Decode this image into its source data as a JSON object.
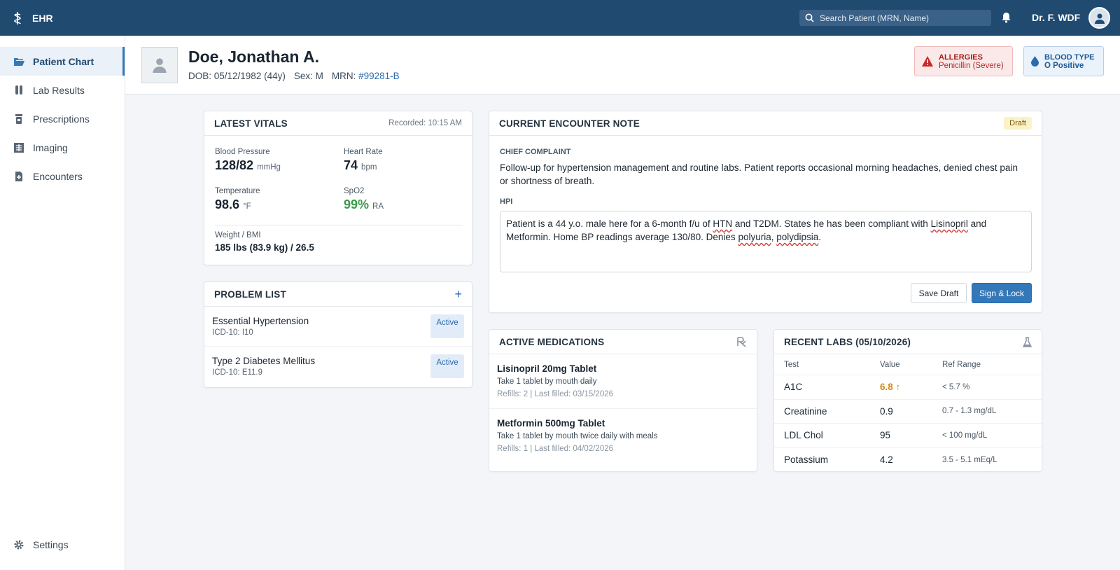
{
  "app": {
    "name": "EHR"
  },
  "topbar": {
    "search_placeholder": "Search Patient (MRN, Name)",
    "user_name": "Dr. F. WDF"
  },
  "sidebar": {
    "items": [
      {
        "label": "Patient Chart",
        "icon": "folder-open-icon",
        "active": true
      },
      {
        "label": "Lab Results",
        "icon": "test-tubes-icon",
        "active": false
      },
      {
        "label": "Prescriptions",
        "icon": "pill-bottle-icon",
        "active": false
      },
      {
        "label": "Imaging",
        "icon": "xray-icon",
        "active": false
      },
      {
        "label": "Encounters",
        "icon": "file-medical-icon",
        "active": false
      }
    ],
    "settings_label": "Settings"
  },
  "patient": {
    "name": "Doe, Jonathan A.",
    "dob": "DOB: 05/12/1982 (44y)",
    "sex": "Sex: M",
    "mrn_label": "MRN:",
    "mrn": "#99281-B",
    "allergies_label": "ALLERGIES",
    "allergies_value": "Penicillin (Severe)",
    "blood_type_label": "BLOOD TYPE",
    "blood_type_value": "O Positive"
  },
  "vitals": {
    "title": "LATEST VITALS",
    "recorded": "Recorded: 10:15 AM",
    "bp_label": "Blood Pressure",
    "bp_value": "128/82",
    "bp_unit": "mmHg",
    "hr_label": "Heart Rate",
    "hr_value": "74",
    "hr_unit": "bpm",
    "temp_label": "Temperature",
    "temp_value": "98.6",
    "temp_unit": "°F",
    "spo2_label": "SpO2",
    "spo2_value": "99%",
    "spo2_unit": "RA",
    "weight_label": "Weight / BMI",
    "weight_value": "185 lbs (83.9 kg) / 26.5"
  },
  "problems": {
    "title": "PROBLEM LIST",
    "add": "+",
    "items": [
      {
        "name": "Essential Hypertension",
        "code": "ICD-10: I10",
        "status": "Active"
      },
      {
        "name": "Type 2 Diabetes Mellitus",
        "code": "ICD-10: E11.9",
        "status": "Active"
      }
    ]
  },
  "note": {
    "title": "CURRENT ENCOUNTER NOTE",
    "status": "Draft",
    "cc_label": "CHIEF COMPLAINT",
    "cc_text": "Follow-up for hypertension management and routine labs. Patient reports occasional morning headaches, denied chest pain or shortness of breath.",
    "hpi_label": "HPI",
    "hpi_parts": [
      "Patient is a 44 y.o. male here for a 6-month f/u of ",
      "HTN",
      " and T2DM. States he has been compliant with ",
      "Lisinopril",
      " and Metformin. Home BP readings average 130/80. Denies ",
      "polyuria",
      ", ",
      "polydipsia",
      "."
    ],
    "save_draft": "Save Draft",
    "sign_lock": "Sign & Lock"
  },
  "medications": {
    "title": "ACTIVE MEDICATIONS",
    "items": [
      {
        "name": "Lisinopril 20mg Tablet",
        "sig": "Take 1 tablet by mouth daily",
        "fill": "Refills: 2 | Last filled: 03/15/2026"
      },
      {
        "name": "Metformin 500mg Tablet",
        "sig": "Take 1 tablet by mouth twice daily with meals",
        "fill": "Refills: 1 | Last filled: 04/02/2026"
      }
    ]
  },
  "labs": {
    "title": "RECENT LABS (05/10/2026)",
    "columns": [
      "Test",
      "Value",
      "Ref Range"
    ],
    "rows": [
      {
        "test": "A1C",
        "value": "6.8 ↑",
        "ref": "< 5.7 %",
        "abnormal": true
      },
      {
        "test": "Creatinine",
        "value": "0.9",
        "ref": "0.7 - 1.3 mg/dL",
        "abnormal": false
      },
      {
        "test": "LDL Chol",
        "value": "95",
        "ref": "< 100 mg/dL",
        "abnormal": false
      },
      {
        "test": "Potassium",
        "value": "4.2",
        "ref": "3.5 - 5.1 mEq/L",
        "abnormal": false
      }
    ]
  },
  "colors": {
    "topbar": "#204a70",
    "accent": "#3378b9",
    "alert": "#a31d1d",
    "normal_green": "#3a9a48",
    "abnormal_amber": "#d48a12"
  }
}
